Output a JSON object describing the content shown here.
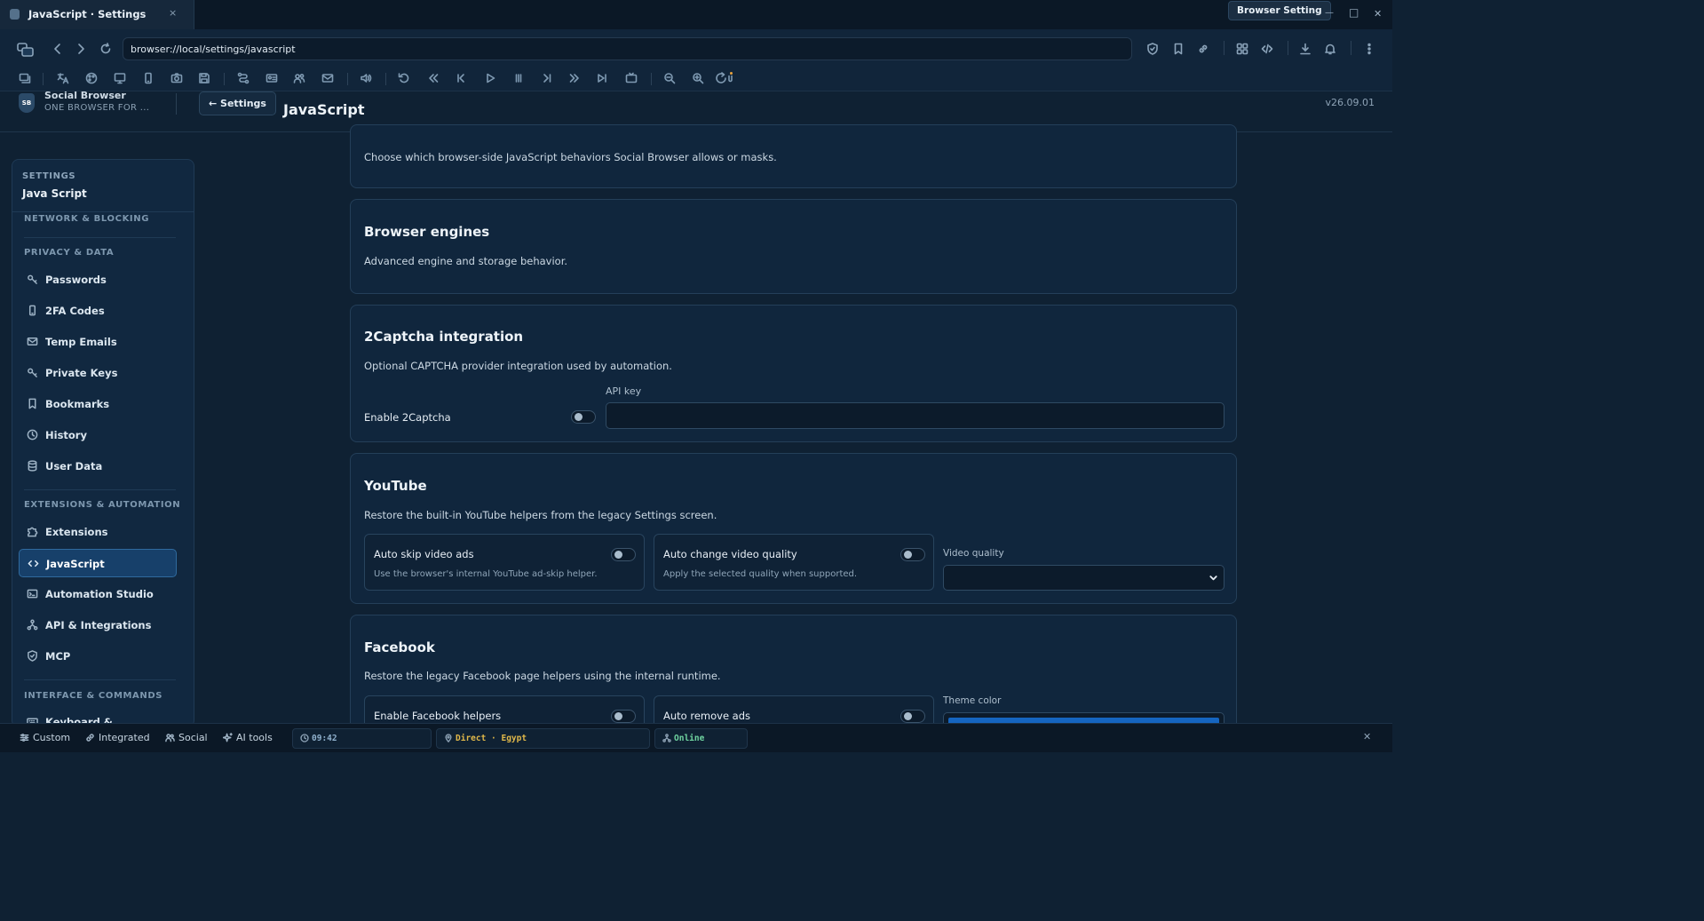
{
  "window": {
    "tab_title": "JavaScript · Settings",
    "tab_close": "×",
    "browser_setting_button": "Browser Setting",
    "minimize": "—",
    "maximize": "□",
    "close": "✕"
  },
  "address_bar": {
    "url": "browser://local/settings/javascript"
  },
  "header": {
    "logo_text": "SB",
    "app_name": "Social Browser",
    "app_tagline": "ONE BROWSER FOR ...",
    "back_button": "← Settings",
    "page_title": "JavaScript",
    "version": "v26.09.01"
  },
  "sidebar": {
    "kicker": "SETTINGS",
    "current": "Java Script",
    "sections": {
      "network": "NETWORK & BLOCKING",
      "privacy": "PRIVACY & DATA",
      "extensions": "EXTENSIONS & AUTOMATION",
      "interface": "INTERFACE & COMMANDS"
    },
    "privacy_items": [
      {
        "label": "Passwords",
        "icon": "key-icon"
      },
      {
        "label": "2FA Codes",
        "icon": "phone-icon"
      },
      {
        "label": "Temp Emails",
        "icon": "mail-icon"
      },
      {
        "label": "Private Keys",
        "icon": "key-icon"
      },
      {
        "label": "Bookmarks",
        "icon": "bookmark-icon"
      },
      {
        "label": "History",
        "icon": "clock-icon"
      },
      {
        "label": "User Data",
        "icon": "database-icon"
      }
    ],
    "extension_items": [
      {
        "label": "Extensions",
        "icon": "puzzle-icon"
      },
      {
        "label": "JavaScript",
        "icon": "code-icon",
        "active": true
      },
      {
        "label": "Automation Studio",
        "icon": "terminal-icon"
      },
      {
        "label": "API & Integrations",
        "icon": "network-icon"
      },
      {
        "label": "MCP",
        "icon": "shield-icon"
      }
    ],
    "interface_items": [
      {
        "label": "Keyboard & Commands",
        "icon": "keyboard-icon"
      }
    ]
  },
  "intro": {
    "description": "Choose which browser-side JavaScript behaviors Social Browser allows or masks."
  },
  "engines": {
    "title": "Browser engines",
    "description": "Advanced engine and storage behavior."
  },
  "captcha": {
    "title": "2Captcha integration",
    "description": "Optional CAPTCHA provider integration used by automation.",
    "enable_label": "Enable 2Captcha",
    "enabled": false,
    "api_key_label": "API key",
    "api_key_value": ""
  },
  "youtube": {
    "title": "YouTube",
    "description": "Restore the built-in YouTube helpers from the legacy Settings screen.",
    "auto_skip_title": "Auto skip video ads",
    "auto_skip_desc": "Use the browser's internal YouTube ad-skip helper.",
    "auto_skip_enabled": false,
    "auto_quality_title": "Auto change video quality",
    "auto_quality_desc": "Apply the selected quality when supported.",
    "auto_quality_enabled": false,
    "quality_label": "Video quality",
    "quality_value": ""
  },
  "facebook": {
    "title": "Facebook",
    "description": "Restore the legacy Facebook page helpers using the internal runtime.",
    "helpers_title": "Enable Facebook helpers",
    "helpers_enabled": false,
    "remove_ads_title": "Auto remove ads",
    "remove_ads_enabled": false,
    "theme_label": "Theme color",
    "theme_color": "#1565c0"
  },
  "statusbar": {
    "custom": "Custom",
    "integrated": "Integrated",
    "social": "Social",
    "ai_tools": "AI tools",
    "time": "09:42",
    "connection": "Direct · Egypt",
    "network": "Online",
    "close": "✕"
  },
  "colors": {
    "accent": "#1565c0",
    "active_item": "#17406a",
    "time_color": "#8fb0cc",
    "connection_color": "#e0b84a",
    "online_color": "#6fd3a0"
  }
}
